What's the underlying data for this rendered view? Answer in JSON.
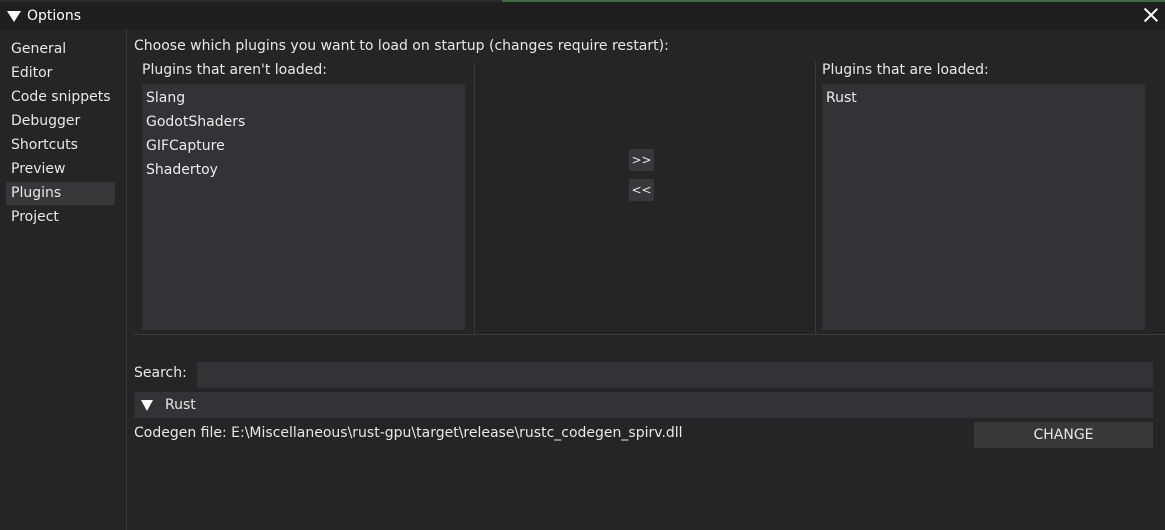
{
  "window": {
    "title": "Options"
  },
  "sidebar": {
    "items": [
      {
        "label": "General"
      },
      {
        "label": "Editor"
      },
      {
        "label": "Code snippets"
      },
      {
        "label": "Debugger"
      },
      {
        "label": "Shortcuts"
      },
      {
        "label": "Preview"
      },
      {
        "label": "Plugins",
        "selected": true
      },
      {
        "label": "Project"
      }
    ]
  },
  "plugins": {
    "heading": "Choose which plugins you want to load on startup (changes require restart):",
    "not_loaded_label": "Plugins that aren't loaded:",
    "not_loaded": [
      "Slang",
      "GodotShaders",
      "GIFCapture",
      "Shadertoy"
    ],
    "loaded_label": "Plugins that are loaded:",
    "loaded": [
      "Rust"
    ],
    "move_right_label": ">>",
    "move_left_label": "<<"
  },
  "search": {
    "label": "Search:",
    "value": ""
  },
  "rust_section": {
    "header": "Rust",
    "codegen_text": "Codegen file: E:\\Miscellaneous\\rust-gpu\\target\\release\\rustc_codegen_spirv.dll",
    "change_label": "CHANGE"
  },
  "colors": {
    "background": "#252526",
    "panel": "#333337",
    "button": "#38383b",
    "selection": "#37373a"
  }
}
